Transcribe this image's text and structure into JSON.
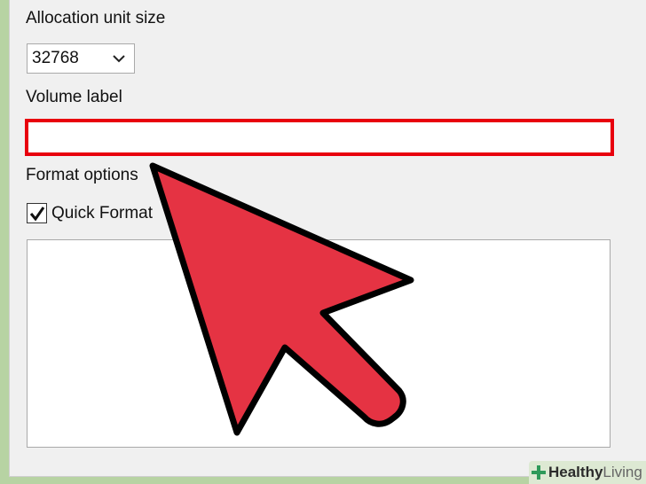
{
  "allocation": {
    "label": "Allocation unit size",
    "selected": "32768"
  },
  "volume": {
    "label": "Volume label",
    "value": ""
  },
  "format_options": {
    "label": "Format options",
    "quick_format_label": "Quick Format",
    "quick_format_checked": true
  },
  "cursor": {
    "icon": "arrow-cursor-icon",
    "fill_color": "#e53343",
    "outline_color": "#000000"
  },
  "highlight_color": "#e8000d",
  "watermark": {
    "text_bold": "Healthy",
    "text_light": "Living"
  }
}
